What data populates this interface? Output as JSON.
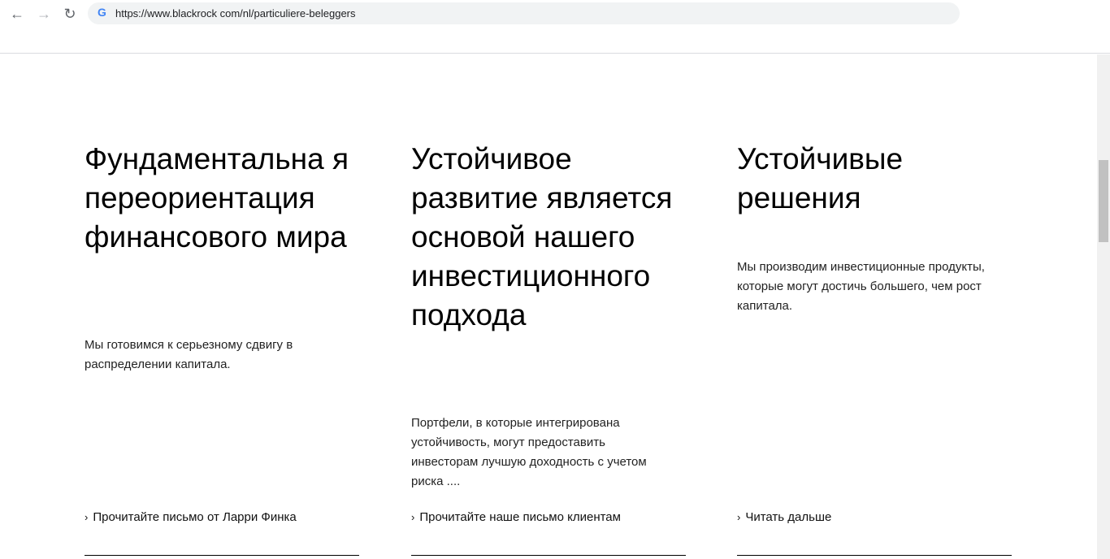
{
  "browser": {
    "url": "https://www.blackrock com/nl/particuliere-beleggers",
    "back_icon": "←",
    "forward_icon": "→",
    "reload_icon": "↻",
    "google_icon": "G"
  },
  "columns": [
    {
      "heading": "Фундаментальна я переориентация финансового мира",
      "body": "Мы готовимся к серьезному сдвигу в распределении капитала.",
      "link": "Прочитайте письмо от Ларри Финка"
    },
    {
      "heading": "Устойчивое развитие является основой нашего инвестиционного подхода",
      "body": "Портфели, в которые интегрирована устойчивость, могут предоставить инвесторам лучшую доходность с учетом риска ....",
      "link": "Прочитайте наше письмо клиентам"
    },
    {
      "heading": "Устойчивые решения",
      "body": "Мы производим инвестиционные продукты, которые могут достичь большего, чем рост капитала.",
      "link": "Читать дальше"
    }
  ],
  "chevron": "›"
}
